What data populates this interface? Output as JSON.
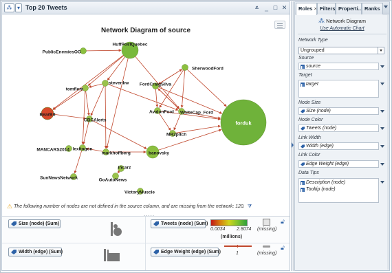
{
  "window": {
    "title": "Top 20 Tweets"
  },
  "chart": {
    "title": "Network Diagram of source"
  },
  "chart_data": {
    "type": "network",
    "title": "Network Diagram of source",
    "nodes": [
      {
        "label": "PublicEnemiesOG",
        "size": "small",
        "color": "#8cbf3f"
      },
      {
        "label": "HuffPostQuebec",
        "size": "large",
        "color": "#79b93c"
      },
      {
        "label": "SherwoodFord",
        "size": "small",
        "color": "#8cbf3f"
      },
      {
        "label": "stevenkw",
        "size": "small",
        "color": "#9ac24a"
      },
      {
        "label": "tomflem",
        "size": "small",
        "color": "#9ac24a"
      },
      {
        "label": "FordCraigSilva",
        "size": "small",
        "color": "#8cbf3f"
      },
      {
        "label": "BearBit",
        "size": "medium",
        "color": "#d74a2a"
      },
      {
        "label": "CBCAlerts",
        "size": "small",
        "color": "#9ac24a"
      },
      {
        "label": "AvalonFord",
        "size": "small",
        "color": "#9ac24a"
      },
      {
        "label": "WhiteCap_Ford",
        "size": "small",
        "color": "#9ac24a"
      },
      {
        "label": "forduk",
        "size": "largest",
        "color": "#6fb23a"
      },
      {
        "label": "MR2pitch",
        "size": "small",
        "color": "#9ac24a"
      },
      {
        "label": "MANCARS2014",
        "size": "small",
        "color": "#9ac24a"
      },
      {
        "label": "lexitogon",
        "size": "small",
        "color": "#9ac24a"
      },
      {
        "label": "markhoffberg",
        "size": "small",
        "color": "#9ac24a"
      },
      {
        "label": "banovsky",
        "size": "medium",
        "color": "#8cbf3f"
      },
      {
        "label": "SunNewsNetwork",
        "size": "small",
        "color": "#9ac24a"
      },
      {
        "label": "GoAutoNews",
        "size": "small",
        "color": "#9ac24a"
      },
      {
        "label": "incarz",
        "size": "small",
        "color": "#9ac24a"
      },
      {
        "label": "VictoryMuscle",
        "size": "small",
        "color": "#9ac24a"
      }
    ],
    "link_color": "#c0472c"
  },
  "warning": {
    "text": "The following number of nodes are not defined in the source column, and are missing from the network: 120.",
    "icon": "warning-icon"
  },
  "legend": {
    "size_chip": "Size (node) (Sum)",
    "width_chip": "Width (edge) (Sum)",
    "tweets_chip": "Tweets (node) (Sum)",
    "edge_chip": "Edge Weight (edge) (Sum)",
    "tweets_min": "0.0034",
    "tweets_max": "2.8074",
    "tweets_unit": "(millions)",
    "missing": "(missing)",
    "missing2": "(missing)",
    "edge_value": "1"
  },
  "tabs": {
    "roles": "Roles",
    "filters": "Filters",
    "properties": "Properti...",
    "ranks": "Ranks"
  },
  "roles": {
    "header": "Network Diagram",
    "auto_link": "Use Automatic Chart",
    "network_type_label": "Network Type",
    "network_type_value": "Ungrouped",
    "source_label": "Source",
    "source_value": "source",
    "target_label": "Target",
    "target_value": "target",
    "node_size_label": "Node Size",
    "node_size_value": "Size (node)",
    "node_color_label": "Node Color",
    "node_color_value": "Tweets (node)",
    "link_width_label": "Link Width",
    "link_width_value": "Width (edge)",
    "link_color_label": "Link Color",
    "link_color_value": "Edge Weight (edge)",
    "data_tips_label": "Data Tips",
    "data_tip_1": "Description (node)",
    "data_tip_2": "Tooltip (node)"
  }
}
